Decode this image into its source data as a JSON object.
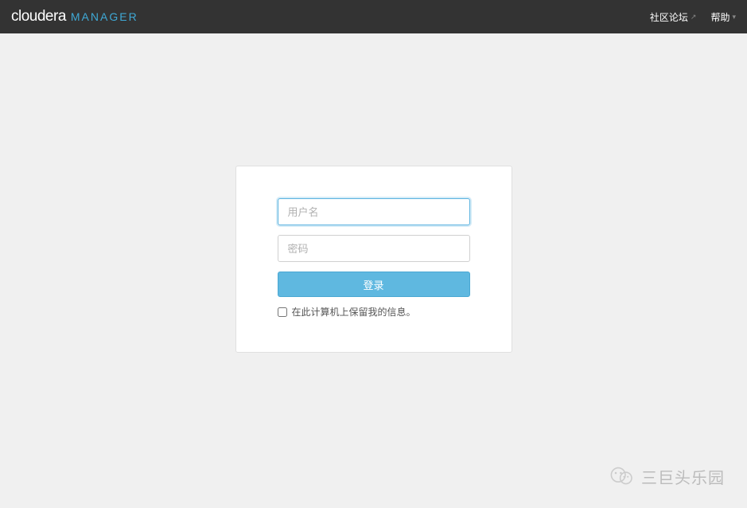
{
  "header": {
    "logo_primary": "cloudera",
    "logo_secondary": "MANAGER",
    "nav": {
      "community_link": "社区论坛",
      "help_link": "帮助"
    }
  },
  "login": {
    "username_placeholder": "用户名",
    "username_value": "",
    "password_placeholder": "密码",
    "password_value": "",
    "submit_label": "登录",
    "remember_label": "在此计算机上保留我的信息。"
  },
  "watermark": {
    "text": "三巨头乐园"
  }
}
